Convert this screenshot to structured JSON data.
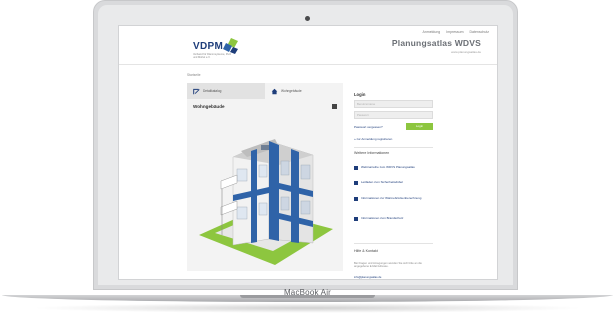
{
  "device": {
    "brand_label": "MacBook Air"
  },
  "topnav": {
    "items": [
      "Anmeldung",
      "Impressum",
      "Datenschutz"
    ]
  },
  "logo": {
    "text": "VDPM",
    "subtext": "Verband für Dämmsysteme, Putz und Mörtel e.V."
  },
  "header": {
    "title": "Planungsatlas WDVS",
    "subtitle": "www.planungsatlas.de"
  },
  "breadcrumb": "Startseite",
  "left_panel": {
    "tabs": [
      {
        "label": "Detailkatalog",
        "icon": "pen-ruler-icon"
      },
      {
        "label": "Wohngebäude",
        "icon": "house-icon"
      }
    ],
    "title": "Wohngebäude"
  },
  "login": {
    "title": "Login",
    "username_placeholder": "Benutzername",
    "password_placeholder": "Passwort",
    "forgot_label": "Passwort vergessen?",
    "submit_label": "Login",
    "register_label": "» zur Anmeldung registrieren"
  },
  "info": {
    "title": "Weitere Informationen",
    "links": [
      "Webinarreihe zum WDVS Planungsatlas",
      "Leitfaden zum Sicherheitsdübel",
      "Informationen zur Wärmebrückenberechnung",
      "Informationen zum Brandschutz"
    ]
  },
  "contact": {
    "title": "Hilfe & Kontakt",
    "text": "Bei Fragen und Anregungen wenden Sie sich bitte an die angegebene E-Mail Adresse.",
    "email": "info@planungsatlas.de"
  },
  "colors": {
    "brand_blue": "#1e3d7a",
    "accent_green": "#8dc63f",
    "facade_blue": "#2f63a8"
  }
}
